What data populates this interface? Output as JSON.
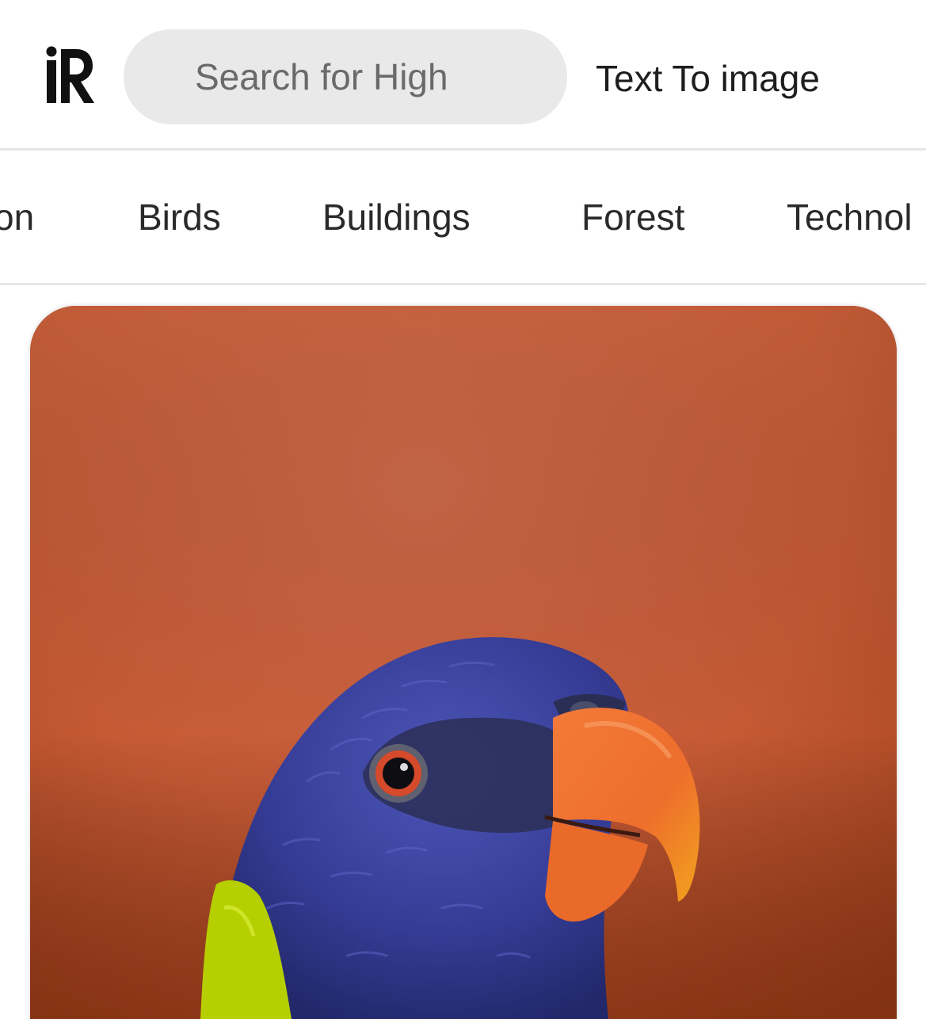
{
  "header": {
    "logo_text": "iR",
    "search": {
      "placeholder": "Search for High",
      "value": ""
    },
    "text_to_image_label": "Text To image"
  },
  "categories": {
    "items": [
      {
        "label": "on"
      },
      {
        "label": "Birds"
      },
      {
        "label": "Buildings"
      },
      {
        "label": "Forest"
      },
      {
        "label": "Technol"
      }
    ]
  },
  "card": {
    "image_subject": "rainbow lorikeet parrot head on orange background"
  },
  "colors": {
    "search_bg": "#e9e9e9",
    "divider": "#e6e6e6",
    "photo_bg": "#c9623f",
    "parrot_blue": "#3a3f9a",
    "beak_orange": "#f07a34",
    "collar_green": "#b5d000"
  }
}
